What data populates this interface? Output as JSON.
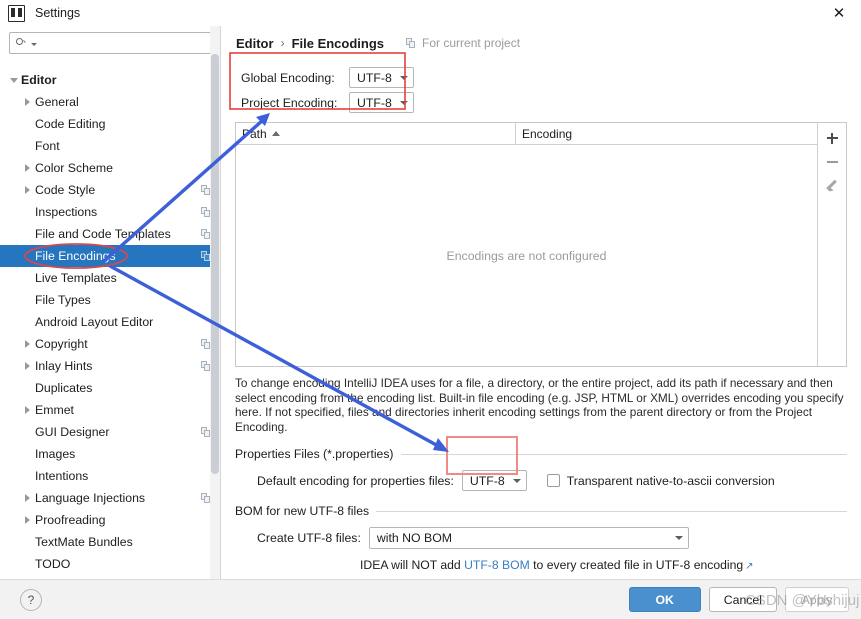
{
  "window": {
    "title": "Settings",
    "app_icon": "intellij-idea-icon",
    "close_icon": "close-icon"
  },
  "sidebar": {
    "search": {
      "placeholder": "",
      "value": "",
      "icon": "search-icon"
    },
    "items": [
      {
        "label": "",
        "indent": 1,
        "arrow": "none",
        "clipped": true,
        "copy": false,
        "selected": false
      },
      {
        "label": "Editor",
        "indent": 0,
        "arrow": "down",
        "bold": true,
        "copy": false,
        "selected": false
      },
      {
        "label": "General",
        "indent": 1,
        "arrow": "right",
        "copy": false,
        "selected": false
      },
      {
        "label": "Code Editing",
        "indent": 1,
        "arrow": "none",
        "copy": false,
        "selected": false
      },
      {
        "label": "Font",
        "indent": 1,
        "arrow": "none",
        "copy": false,
        "selected": false
      },
      {
        "label": "Color Scheme",
        "indent": 1,
        "arrow": "right",
        "copy": false,
        "selected": false
      },
      {
        "label": "Code Style",
        "indent": 1,
        "arrow": "right",
        "copy": true,
        "selected": false
      },
      {
        "label": "Inspections",
        "indent": 1,
        "arrow": "none",
        "copy": true,
        "selected": false
      },
      {
        "label": "File and Code Templates",
        "indent": 1,
        "arrow": "none",
        "copy": true,
        "selected": false
      },
      {
        "label": "File Encodings",
        "indent": 1,
        "arrow": "none",
        "copy": true,
        "selected": true
      },
      {
        "label": "Live Templates",
        "indent": 1,
        "arrow": "none",
        "copy": false,
        "selected": false
      },
      {
        "label": "File Types",
        "indent": 1,
        "arrow": "none",
        "copy": false,
        "selected": false
      },
      {
        "label": "Android Layout Editor",
        "indent": 1,
        "arrow": "none",
        "copy": false,
        "selected": false
      },
      {
        "label": "Copyright",
        "indent": 1,
        "arrow": "right",
        "copy": true,
        "selected": false
      },
      {
        "label": "Inlay Hints",
        "indent": 1,
        "arrow": "right",
        "copy": true,
        "selected": false
      },
      {
        "label": "Duplicates",
        "indent": 1,
        "arrow": "none",
        "copy": false,
        "selected": false
      },
      {
        "label": "Emmet",
        "indent": 1,
        "arrow": "right",
        "copy": false,
        "selected": false
      },
      {
        "label": "GUI Designer",
        "indent": 1,
        "arrow": "none",
        "copy": true,
        "selected": false
      },
      {
        "label": "Images",
        "indent": 1,
        "arrow": "none",
        "copy": false,
        "selected": false
      },
      {
        "label": "Intentions",
        "indent": 1,
        "arrow": "none",
        "copy": false,
        "selected": false
      },
      {
        "label": "Language Injections",
        "indent": 1,
        "arrow": "right",
        "copy": true,
        "selected": false
      },
      {
        "label": "Proofreading",
        "indent": 1,
        "arrow": "right",
        "copy": false,
        "selected": false
      },
      {
        "label": "TextMate Bundles",
        "indent": 1,
        "arrow": "none",
        "copy": false,
        "selected": false
      },
      {
        "label": "TODO",
        "indent": 1,
        "arrow": "none",
        "copy": false,
        "selected": false
      }
    ]
  },
  "breadcrumb": {
    "parent": "Editor",
    "separator": "›",
    "current": "File Encodings",
    "scope_label": "For current project",
    "scope_icon": "copy-config-icon"
  },
  "encoding": {
    "global_label": "Global Encoding:",
    "global_value": "UTF-8",
    "project_label": "Project Encoding:",
    "project_value": "UTF-8"
  },
  "table": {
    "columns": [
      "Path",
      "Encoding"
    ],
    "sort_column": "Path",
    "sort_direction": "ascending",
    "empty_message": "Encodings are not configured",
    "rows": [],
    "tools": [
      {
        "name": "add-button",
        "icon": "plus-icon"
      },
      {
        "name": "remove-button",
        "icon": "minus-icon"
      },
      {
        "name": "edit-button",
        "icon": "pencil-icon"
      }
    ]
  },
  "help_text": "To change encoding IntelliJ IDEA uses for a file, a directory, or the entire project, add its path if necessary and then select encoding from the encoding list. Built-in file encoding (e.g. JSP, HTML or XML) overrides encoding you specify here. If not specified, files and directories inherit encoding settings from the parent directory or from the Project Encoding.",
  "properties_group": {
    "title": "Properties Files (*.properties)",
    "default_encoding_label": "Default encoding for properties files:",
    "default_encoding_value": "UTF-8",
    "transparent_checkbox_label": "Transparent native-to-ascii conversion",
    "transparent_checked": false
  },
  "bom_group": {
    "title": "BOM for new UTF-8 files",
    "create_label": "Create UTF-8 files:",
    "create_value": "with NO BOM",
    "note_prefix": "IDEA will NOT add ",
    "note_link": "UTF-8 BOM",
    "note_suffix": " to every created file in UTF-8 encoding",
    "external_link_icon": "external-link-icon"
  },
  "footer": {
    "help_label": "?",
    "ok_label": "OK",
    "cancel_label": "Cancel",
    "apply_label": "Apply"
  },
  "annotations": {
    "watermark": "CSDN @Ybshijuj",
    "accent_red": "#e8403a",
    "accent_blue": "#3d5fd9",
    "highlight_blue": "#2675bf",
    "link_blue": "#3a7fc1"
  }
}
